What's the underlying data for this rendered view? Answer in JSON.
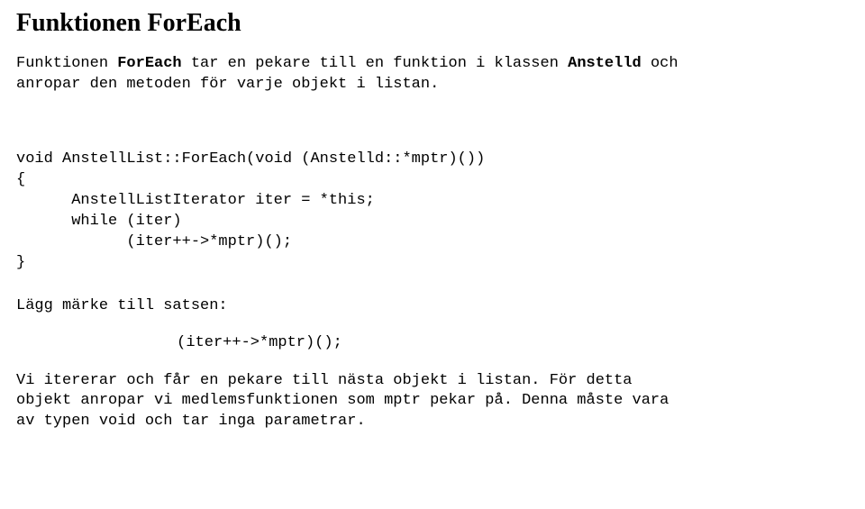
{
  "heading": "Funktionen ForEach",
  "intro_pre": "Funktionen ",
  "intro_bold1": "ForEach",
  "intro_mid1": " tar en pekare till en funktion i klassen ",
  "intro_bold2": "Anstelld",
  "intro_mid2": " och\nanropar den metoden för varje objekt i listan.",
  "code": "void AnstellList::ForEach(void (Anstelld::*mptr)())\n{\n      AnstellListIterator iter = *this;\n      while (iter)\n            (iter++->*mptr)();\n}",
  "label": "Lägg märke till satsen:",
  "expr": "(iter++->*mptr)();",
  "outro": "Vi itererar och får en pekare till nästa objekt i listan. För detta\nobjekt anropar vi medlemsfunktionen som mptr pekar på. Denna måste vara\nav typen void och tar inga parametrar."
}
